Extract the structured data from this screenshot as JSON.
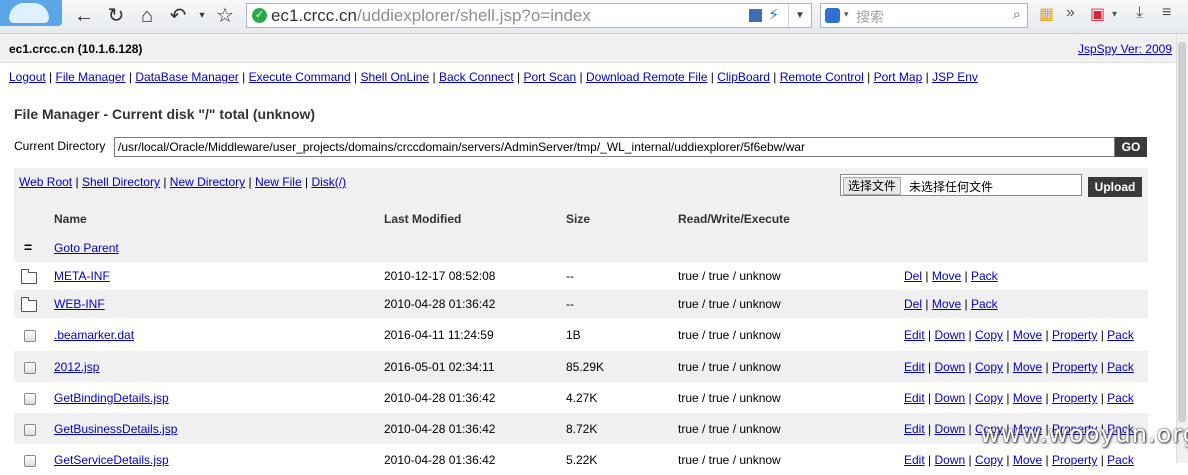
{
  "browser": {
    "url_host": "ec1.crcc.cn",
    "url_path": "/uddiexplorer/shell.jsp?o=index",
    "search_placeholder": "搜索",
    "search_engine_arrow": "▾"
  },
  "header": {
    "host": "ec1.crcc.cn (10.1.6.128)",
    "version": "JspSpy Ver: 2009"
  },
  "nav": [
    "Logout",
    "File Manager",
    "DataBase Manager",
    "Execute Command",
    "Shell OnLine",
    "Back Connect",
    "Port Scan",
    "Download Remote File",
    "ClipBoard",
    "Remote Control",
    "Port Map",
    "JSP Env"
  ],
  "main": {
    "title": "File Manager - Current disk \"/\" total (unknow)",
    "current_dir_label": "Current Directory",
    "current_dir_value": "/usr/local/Oracle/Middleware/user_projects/domains/crccdomain/servers/AdminServer/tmp/_WL_internal/uddiexplorer/5f6ebw/war",
    "go_label": "GO",
    "op_links": [
      "Web Root",
      "Shell Directory",
      "New Directory",
      "New File",
      "Disk(/)"
    ],
    "file_choose_label": "选择文件",
    "file_none_label": "未选择任何文件",
    "upload_label": "Upload"
  },
  "table": {
    "headers": [
      "Name",
      "Last Modified",
      "Size",
      "Read/Write/Execute"
    ],
    "parent_label": "Goto Parent",
    "rows": [
      {
        "kind": "folder",
        "name": "META-INF",
        "modified": "2010-12-17 08:52:08",
        "size": "--",
        "rwx": "true / true / unknow",
        "actions": [
          "Del",
          "Move",
          "Pack"
        ]
      },
      {
        "kind": "folder",
        "name": "WEB-INF",
        "modified": "2010-04-28 01:36:42",
        "size": "--",
        "rwx": "true / true / unknow",
        "actions": [
          "Del",
          "Move",
          "Pack"
        ]
      },
      {
        "kind": "file",
        "name": ".beamarker.dat",
        "modified": "2016-04-11 11:24:59",
        "size": "1B",
        "rwx": "true / true / unknow",
        "actions": [
          "Edit",
          "Down",
          "Copy",
          "Move",
          "Property",
          "Pack"
        ]
      },
      {
        "kind": "file",
        "name": "2012.jsp",
        "modified": "2016-05-01 02:34:11",
        "size": "85.29K",
        "rwx": "true / true / unknow",
        "actions": [
          "Edit",
          "Down",
          "Copy",
          "Move",
          "Property",
          "Pack"
        ]
      },
      {
        "kind": "file",
        "name": "GetBindingDetails.jsp",
        "modified": "2010-04-28 01:36:42",
        "size": "4.27K",
        "rwx": "true / true / unknow",
        "actions": [
          "Edit",
          "Down",
          "Copy",
          "Move",
          "Property",
          "Pack"
        ]
      },
      {
        "kind": "file",
        "name": "GetBusinessDetails.jsp",
        "modified": "2010-04-28 01:36:42",
        "size": "8.72K",
        "rwx": "true / true / unknow",
        "actions": [
          "Edit",
          "Down",
          "Copy",
          "Move",
          "Property",
          "Pack"
        ]
      },
      {
        "kind": "file",
        "name": "GetServiceDetails.jsp",
        "modified": "2010-04-28 01:36:42",
        "size": "5.22K",
        "rwx": "true / true / unknow",
        "actions": [
          "Edit",
          "Down",
          "Copy",
          "Move",
          "Property",
          "Pack"
        ]
      }
    ]
  },
  "watermark": "www.wooyun.org",
  "colors": {
    "link": "#0000cc",
    "button_dark": "#3a3a3a",
    "row_grey": "#f0f0f0"
  }
}
